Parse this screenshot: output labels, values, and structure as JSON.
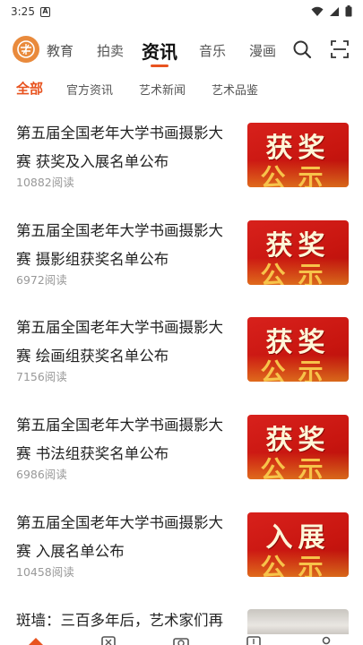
{
  "status_bar": {
    "time": "3:25",
    "badge": "A"
  },
  "nav": {
    "tabs": [
      {
        "label": "教育"
      },
      {
        "label": "拍卖"
      },
      {
        "label": "资讯"
      },
      {
        "label": "音乐"
      },
      {
        "label": "漫画"
      }
    ],
    "active_tab": "资讯",
    "icons": [
      "search-icon",
      "scan-icon"
    ]
  },
  "sub_tabs": [
    {
      "label": "全部"
    },
    {
      "label": "官方资讯"
    },
    {
      "label": "艺术新闻"
    },
    {
      "label": "艺术品鉴"
    }
  ],
  "articles": [
    {
      "title": "第五届全国老年大学书画摄影大赛 获奖及入展名单公布",
      "reads": "10882阅读",
      "thumb_top": "获奖",
      "thumb_bottom": "公示"
    },
    {
      "title": "第五届全国老年大学书画摄影大赛 摄影组获奖名单公布",
      "reads": "6972阅读",
      "thumb_top": "获奖",
      "thumb_bottom": "公示"
    },
    {
      "title": "第五届全国老年大学书画摄影大赛 绘画组获奖名单公布",
      "reads": "7156阅读",
      "thumb_top": "获奖",
      "thumb_bottom": "公示"
    },
    {
      "title": "第五届全国老年大学书画摄影大赛 书法组获奖名单公布",
      "reads": "6986阅读",
      "thumb_top": "获奖",
      "thumb_bottom": "公示"
    },
    {
      "title": "第五届全国老年大学书画摄影大赛 入展名单公布",
      "reads": "10458阅读",
      "thumb_top": "入展",
      "thumb_bottom": "公示"
    }
  ],
  "partial_article": {
    "title": "斑墙：三百多年后，艺术家们再"
  },
  "colors": {
    "accent": "#e8531f",
    "thumb_red": "#d21a14"
  }
}
